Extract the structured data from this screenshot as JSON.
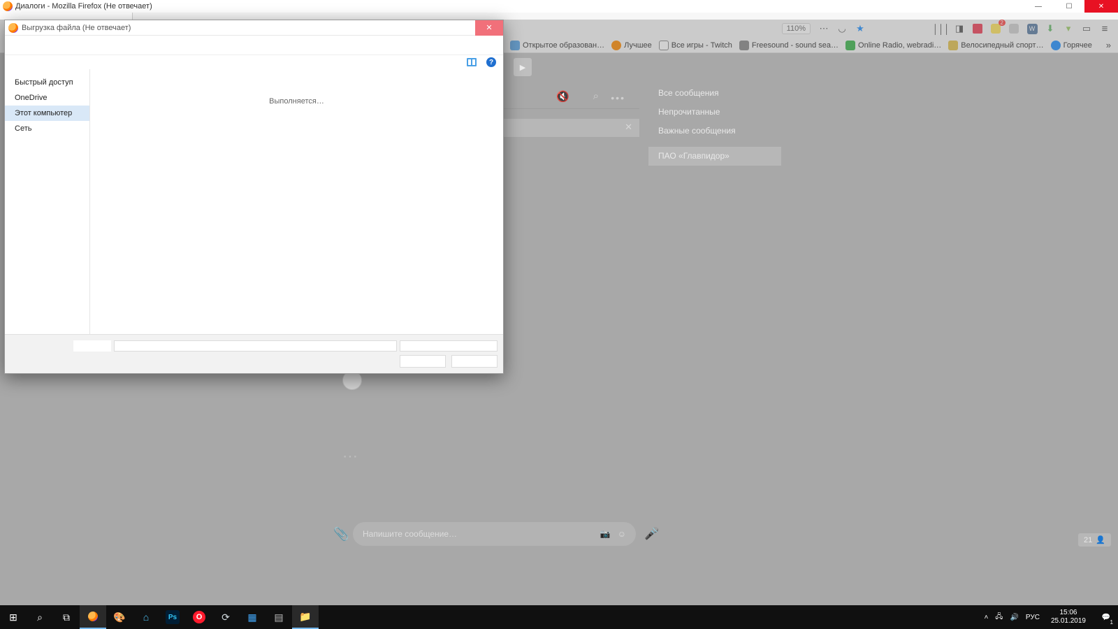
{
  "window": {
    "title": "Диалоги - Mozilla Firefox (Не отвечает)",
    "controls": {
      "min": "—",
      "max": "☐",
      "close": "✕"
    }
  },
  "toolbar": {
    "zoom": "110%",
    "icons": {
      "dots": "⋯",
      "shield": "◡",
      "star": "★",
      "library": "│││",
      "sidebar": "◨",
      "pocket": "",
      "im_badge": "2",
      "vk": "W",
      "dl": "⬇",
      "android": "▾",
      "page": "▭",
      "hamburger": "≡"
    }
  },
  "bookmarks": {
    "items": [
      {
        "label": "Открытое образован…",
        "color": "#5aa7e8"
      },
      {
        "label": "Лучшее",
        "color": "#ff8a00"
      },
      {
        "label": "Все игры - Twitch",
        "color": "#6441a5"
      },
      {
        "label": "Freesound - sound sea…",
        "color": "#888"
      },
      {
        "label": "Online Radio, webradi…",
        "color": "#39b54a"
      },
      {
        "label": "Велосипедный спорт…",
        "color": "#e2c14b"
      },
      {
        "label": "Горячее",
        "color": "#1e90ff"
      }
    ],
    "more": "»"
  },
  "vk": {
    "play": "▶",
    "header": {
      "mute": "🔇",
      "search": "⌕",
      "more": "•••"
    },
    "row_close": "✕",
    "input_placeholder": "Напишите сообщение…",
    "input_icons": {
      "camera": "📷",
      "smile": "☺",
      "clip": "📎",
      "mic": "🎤"
    },
    "side": {
      "items": [
        "Все сообщения",
        "Непрочитанные",
        "Важные сообщения"
      ],
      "selected": "ПАО «Главпидор»"
    },
    "badge": {
      "count": "21",
      "user": "👤"
    }
  },
  "dialog": {
    "title": "Выгрузка файла (Не отвечает)",
    "close": "✕",
    "iconbar": {
      "help": "?"
    },
    "nav": {
      "items": [
        "Быстрый доступ",
        "OneDrive",
        "Этот компьютер",
        "Сеть"
      ],
      "selected_index": 2
    },
    "content_status": "Выполняется…"
  },
  "taskbar": {
    "buttons": {
      "start": "⊞",
      "search": "⌕",
      "taskview": "⧉",
      "firefox": "",
      "paint": "🎨",
      "app3": "⌂",
      "ps": "Ps",
      "opera": "O",
      "steam": "⟳",
      "cards": "▦",
      "calc": "▤",
      "explorer": "📁"
    },
    "tray": {
      "up": "˄",
      "net": "🖧",
      "vol": "🔊",
      "lang": "РУС",
      "time": "15:06",
      "date": "25.01.2019",
      "notif": "💬",
      "notif_count": "1"
    }
  }
}
